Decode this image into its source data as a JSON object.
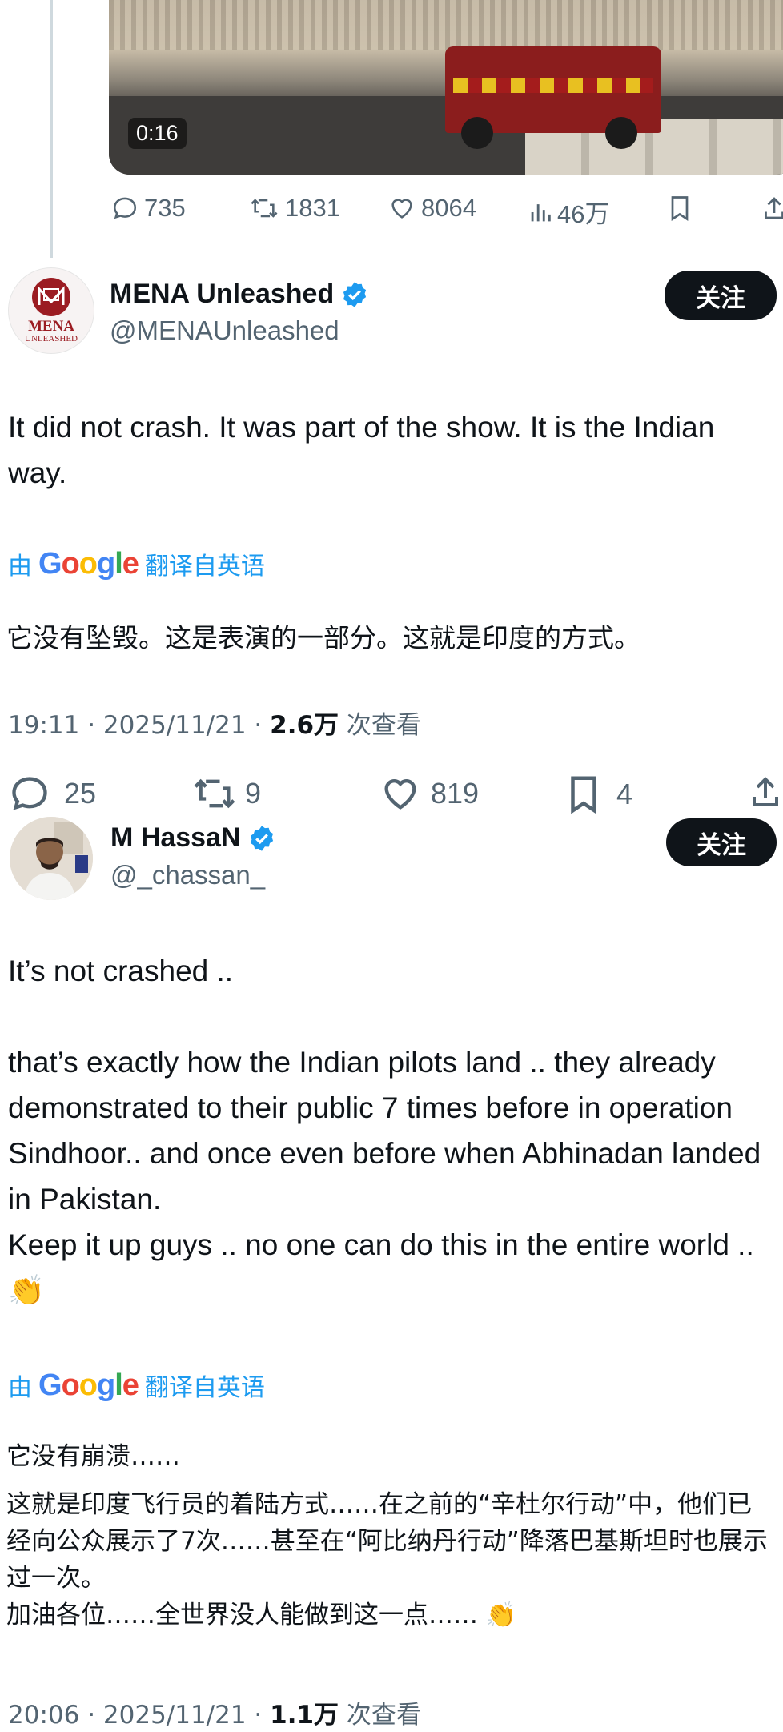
{
  "video": {
    "time": "0:16"
  },
  "top_actions": {
    "replies": "735",
    "reposts": "1831",
    "likes": "8064",
    "views": "46万"
  },
  "tweet1": {
    "name": "MENA Unleashed",
    "handle": "@MENAUnleashed",
    "avatar_text_line1": "MENA",
    "avatar_text_line2": "UNLEASHED",
    "follow": "关注",
    "text": "It did not crash. It was part of the show. It is the Indian way.",
    "translation_label_prefix": "由",
    "translation_label_brand": "Google",
    "translation_label_suffix": "翻译自英语",
    "translation": "它没有坠毁。这是表演的一部分。这就是印度的方式。",
    "meta_time": "19:11 · 2025/11/21 · ",
    "meta_views": "2.6万",
    "meta_views_suffix": " 次查看",
    "replies": "25",
    "reposts": "9",
    "likes": "819",
    "bookmarks": "4"
  },
  "tweet2": {
    "name": "M HassaN",
    "handle": "@_chassan_",
    "follow": "关注",
    "text": "It’s not crashed ..\n\nthat’s exactly how the Indian pilots land .. they already demonstrated to their public 7 times before in operation Sindhoor.. and once even before when Abhinadan landed in Pakistan.\nKeep it up guys .. no one can do this in the entire world .. 👏",
    "translation_label_prefix": "由",
    "translation_label_brand": "Google",
    "translation_label_suffix": "翻译自英语",
    "translation_line1": "它没有崩溃……",
    "translation_line2": "这就是印度飞行员的着陆方式……在之前的“辛杜尔行动”中，他们已经向公众展示了7次……甚至在“阿比纳丹行动”降落巴基斯坦时也展示过一次。\n加油各位……全世界没人能做到这一点…… 👏",
    "meta_time": "20:06 · 2025/11/21 · ",
    "meta_views": "1.1万",
    "meta_views_suffix": " 次查看"
  },
  "colors": {
    "text": "#0f1419",
    "muted": "#536471",
    "link": "#1d9bf0",
    "verified": "#1d9bf0",
    "follow_bg": "#0f1419"
  }
}
